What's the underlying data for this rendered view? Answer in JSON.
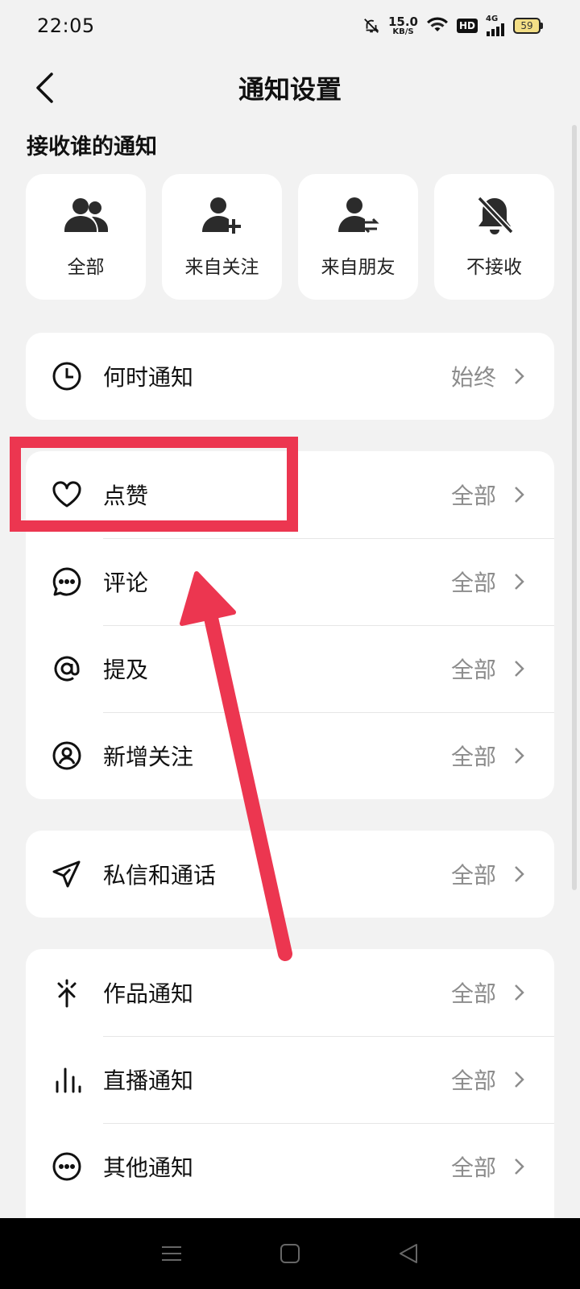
{
  "status_bar": {
    "time": "22:05",
    "net_speed": "15.0",
    "net_unit": "KB/S",
    "hd": "HD",
    "network": "4G",
    "battery": "59"
  },
  "header": {
    "title": "通知设置",
    "back_icon": "back-chevron-icon"
  },
  "who_section": {
    "title": "接收谁的通知",
    "options": [
      {
        "label": "全部",
        "icon": "users-group-icon"
      },
      {
        "label": "来自关注",
        "icon": "user-add-icon"
      },
      {
        "label": "来自朋友",
        "icon": "user-exchange-icon"
      },
      {
        "label": "不接收",
        "icon": "bell-off-icon"
      }
    ]
  },
  "settings": {
    "when": {
      "label": "何时通知",
      "value": "始终",
      "icon": "clock-icon"
    },
    "interactions": [
      {
        "label": "点赞",
        "value": "全部",
        "icon": "heart-icon"
      },
      {
        "label": "评论",
        "value": "全部",
        "icon": "comment-icon"
      },
      {
        "label": "提及",
        "value": "全部",
        "icon": "at-icon"
      },
      {
        "label": "新增关注",
        "value": "全部",
        "icon": "user-circle-icon"
      }
    ],
    "messages": {
      "label": "私信和通话",
      "value": "全部",
      "icon": "send-icon"
    },
    "content": [
      {
        "label": "作品通知",
        "value": "全部",
        "icon": "sparkle-icon"
      },
      {
        "label": "直播通知",
        "value": "全部",
        "icon": "live-bars-icon"
      },
      {
        "label": "其他通知",
        "value": "全部",
        "icon": "more-circle-icon"
      }
    ]
  },
  "annotation": {
    "highlight_color": "#ec3650"
  },
  "colors": {
    "background": "#f2f2f2",
    "card": "#ffffff",
    "value_text": "#8c8c8c"
  }
}
